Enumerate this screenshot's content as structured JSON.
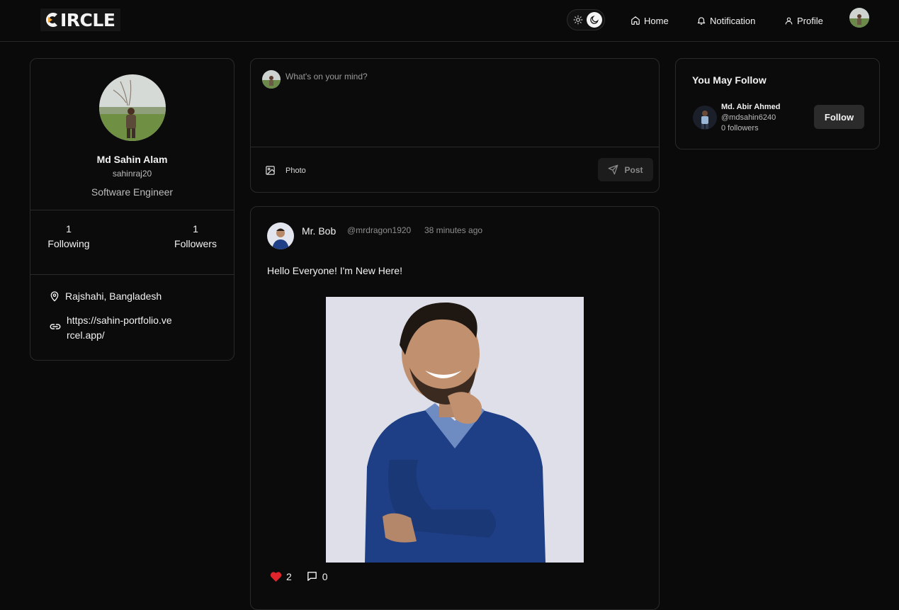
{
  "brand": {
    "logo_text": "IRCLE"
  },
  "nav": {
    "theme_toggle": {
      "mode": "dark",
      "icons": [
        "sun-icon",
        "moon-icon"
      ]
    },
    "items": [
      {
        "label": "Home",
        "icon": "home-icon"
      },
      {
        "label": "Notification",
        "icon": "bell-icon"
      },
      {
        "label": "Profile",
        "icon": "user-icon"
      }
    ]
  },
  "profile": {
    "name": "Md Sahin Alam",
    "username": "sahinraj20",
    "role": "Software Engineer",
    "stats": [
      {
        "value": "1",
        "label": "Following"
      },
      {
        "value": "1",
        "label": "Followers"
      }
    ],
    "location": "Rajshahi, Bangladesh",
    "website": "https://sahin-portfolio.vercel.app/"
  },
  "composer": {
    "placeholder": "What's on your mind?",
    "photo_label": "Photo",
    "post_label": "Post"
  },
  "post": {
    "author": "Mr. Bob",
    "handle": "@mrdragon1920",
    "time": "38 minutes ago",
    "text": "Hello Everyone! I'm New Here!",
    "likes": "2",
    "comments": "0",
    "like_color": "#e0242b"
  },
  "suggestions": {
    "title": "You May Follow",
    "items": [
      {
        "name": "Md. Abir Ahmed",
        "handle": "@mdsahin6240",
        "followers": "0 followers",
        "button_label": "Follow"
      }
    ]
  }
}
